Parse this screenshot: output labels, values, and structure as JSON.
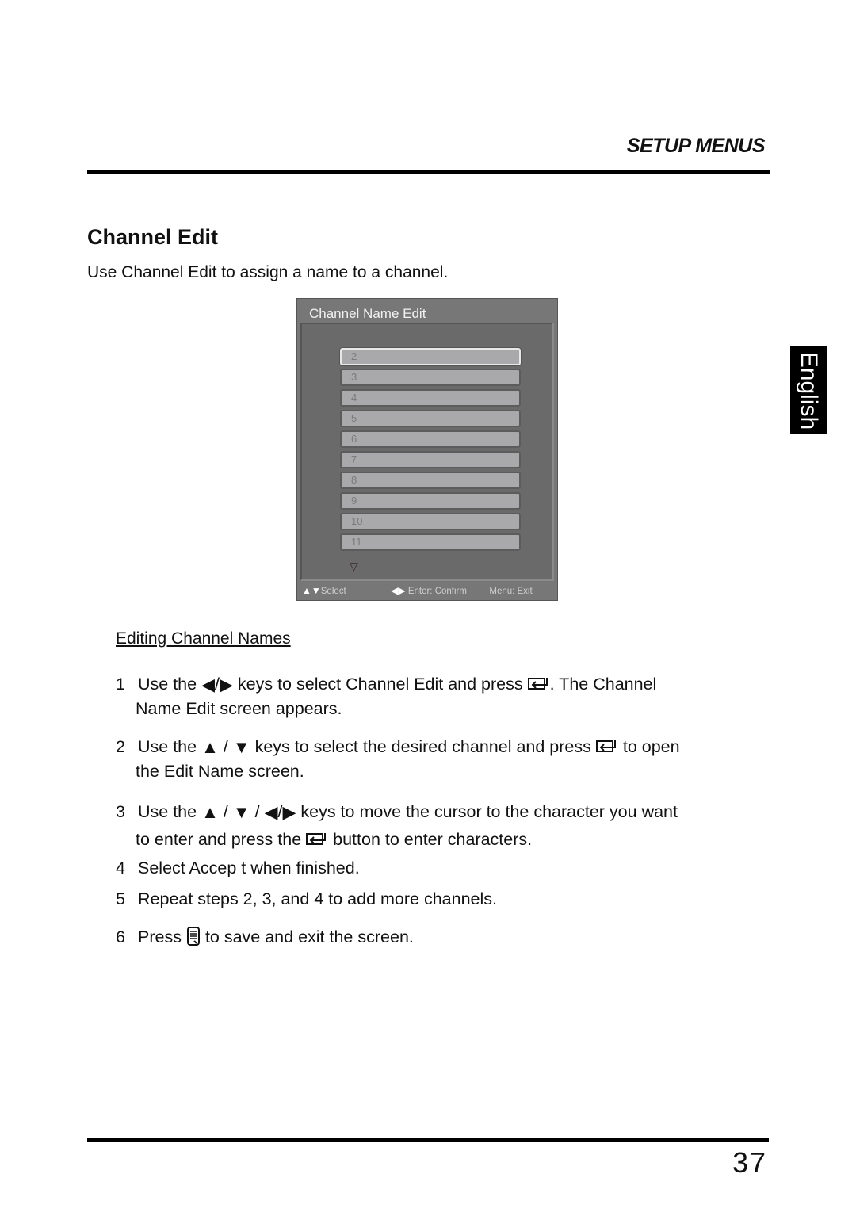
{
  "header": {
    "section": "SETUP MENUS"
  },
  "title": "Channel Edit",
  "intro": "Use Channel Edit to assign a name to a channel.",
  "language_tab": "English",
  "osd": {
    "title": "Channel Name Edit",
    "channels": [
      "2",
      "3",
      "4",
      "5",
      "6",
      "7",
      "8",
      "9",
      "10",
      "11"
    ],
    "selected_index": 0,
    "more_indicator": "▽",
    "footer": {
      "select_icon": "▲▼",
      "select_label": "Select",
      "confirm_icon": "◀▶",
      "confirm_label": "Enter: Confirm",
      "exit_label": "Menu: Exit"
    }
  },
  "subheading": "Editing Channel Names",
  "steps": [
    {
      "num": "1",
      "a": "Use the",
      "b": "keys to select Channel Edit  and press",
      "c": ". The Channel",
      "cont": "Name Edit screen appears."
    },
    {
      "num": "2",
      "a": "Use the",
      "b": "keys to select the desired channel and press",
      "c": "to open",
      "cont": "the Edit Name screen."
    },
    {
      "num": "3",
      "a": "Use the",
      "b": "keys to move the cursor to the character you want",
      "cont_a": "to enter and press the",
      "cont_b": "button to enter characters."
    },
    {
      "num": "4",
      "text": "Select Accep t when finished."
    },
    {
      "num": "5",
      "text": "Repeat steps 2, 3, and 4 to add more channels."
    },
    {
      "num": "6",
      "a": "Press",
      "b": "to save and exit the screen."
    }
  ],
  "icons": {
    "left": "◀",
    "right": "▶",
    "up": "▲",
    "down": "▼",
    "slash": "/"
  },
  "page_number": "37"
}
